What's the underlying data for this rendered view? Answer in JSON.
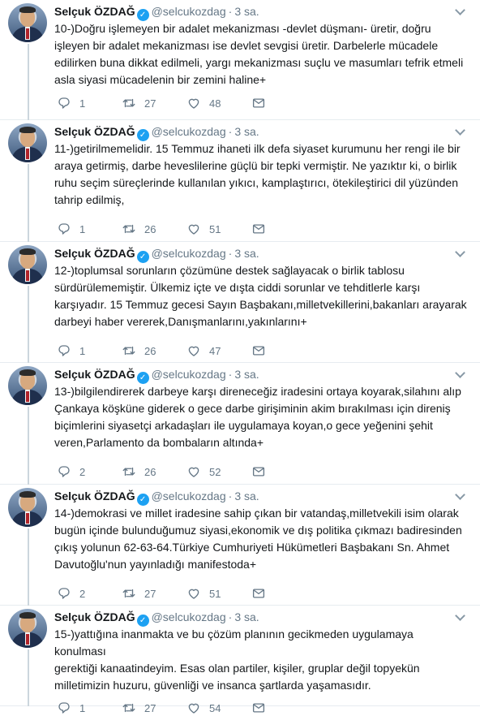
{
  "tweets": [
    {
      "name": "Selçuk ÖZDAĞ",
      "handle": "@selcukozdag",
      "time": "3 sa.",
      "text": "10-)Doğru işlemeyen bir adalet mekanizması -devlet düşmanı- üretir, doğru\nişleyen bir adalet mekanizması ise devlet sevgisi üretir. Darbelerle mücadele\nedilirken buna dikkat edilmeli, yargı mekanizması suçlu ve masumları tefrik etmeli\nasla siyasi mücadelenin bir zemini haline+",
      "replies": "1",
      "retweets": "27",
      "likes": "48"
    },
    {
      "name": "Selçuk ÖZDAĞ",
      "handle": "@selcukozdag",
      "time": "3 sa.",
      "text": "11-)getirilmemelidir. 15 Temmuz ihaneti ilk defa siyaset kurumunu her rengi ile bir\naraya getirmiş, darbe heveslilerine güçlü bir tepki vermiştir. Ne yazıktır ki, o birlik\nruhu seçim süreçlerinde kullanılan yıkıcı, kamplaştırıcı, ötekileştirici dil yüzünden\ntahrip edilmiş,",
      "replies": "1",
      "retweets": "26",
      "likes": "51"
    },
    {
      "name": "Selçuk ÖZDAĞ",
      "handle": "@selcukozdag",
      "time": "3 sa.",
      "text": "12-)toplumsal sorunların çözümüne destek sağlayacak o birlik tablosu\nsürdürülememiştir. Ülkemiz içte ve dışta ciddi sorunlar ve tehditlerle karşı\nkarşıyadır. 15 Temmuz gecesi Sayın Başbakanı,milletvekillerini,bakanları arayarak\ndarbeyi haber vererek,Danışmanlarını,yakınlarını+",
      "replies": "1",
      "retweets": "26",
      "likes": "47"
    },
    {
      "name": "Selçuk ÖZDAĞ",
      "handle": "@selcukozdag",
      "time": "3 sa.",
      "text": "13-)bilgilendirerek darbeye karşı direneceğiz iradesini ortaya koyarak,silahını alıp\nÇankaya köşküne giderek o gece darbe girişiminin akim bırakılması için direniş\nbiçimlerini siyasetçi arkadaşları ile uygulamaya koyan,o gece yeğenini şehit\nveren,Parlamento da bombaların altında+",
      "replies": "2",
      "retweets": "26",
      "likes": "52"
    },
    {
      "name": "Selçuk ÖZDAĞ",
      "handle": "@selcukozdag",
      "time": "3 sa.",
      "text": "14-)demokrasi ve millet iradesine sahip çıkan bir vatandaş,milletvekili isim olarak\nbugün içinde bulunduğumuz siyasi,ekonomik ve dış politika çıkmazı badiresinden\nçıkış yolunun 62-63-64.Türkiye Cumhuriyeti Hükümetleri Başbakanı Sn. Ahmet\nDavutoğlu'nun  yayınladığı manifestoda+",
      "replies": "2",
      "retweets": "27",
      "likes": "51"
    },
    {
      "name": "Selçuk ÖZDAĞ",
      "handle": "@selcukozdag",
      "time": "3 sa.",
      "text": "15-)yattığına inanmakta ve bu çözüm planının gecikmeden uygulamaya konulması\ngerektiği kanaatindeyim. Esas olan partiler, kişiler, gruplar değil topyekün\nmilletimizin huzuru, güvenliği ve insanca şartlarda yaşamasıdır.",
      "replies": "1",
      "retweets": "27",
      "likes": "54"
    }
  ],
  "icons": {
    "verified": "verified-badge-icon",
    "reply": "reply-icon",
    "retweet": "retweet-icon",
    "like": "heart-icon",
    "dm": "envelope-icon",
    "more": "chevron-down-icon"
  },
  "colors": {
    "verified": "#1da1f2",
    "text": "#14171a",
    "muted": "#657786",
    "thread": "#ccd6dd"
  }
}
